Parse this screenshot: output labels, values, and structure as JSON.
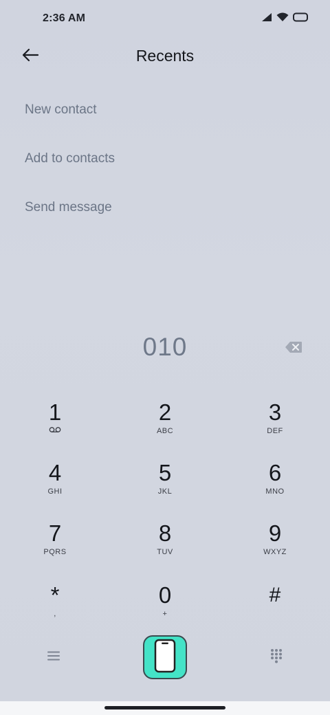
{
  "status_bar": {
    "time": "2:36 AM",
    "icons": [
      "signal-icon",
      "wifi-icon",
      "battery-icon"
    ]
  },
  "header": {
    "back_icon": "arrow-left-icon",
    "title": "Recents"
  },
  "options": [
    {
      "label": "New contact"
    },
    {
      "label": "Add to contacts"
    },
    {
      "label": "Send message"
    }
  ],
  "dialer": {
    "number": "010",
    "backspace_icon": "backspace-icon"
  },
  "keypad": {
    "keys": [
      {
        "digit": "1",
        "letters": "",
        "sub_icon": "voicemail-icon"
      },
      {
        "digit": "2",
        "letters": "ABC"
      },
      {
        "digit": "3",
        "letters": "DEF"
      },
      {
        "digit": "4",
        "letters": "GHI"
      },
      {
        "digit": "5",
        "letters": "JKL"
      },
      {
        "digit": "6",
        "letters": "MNO"
      },
      {
        "digit": "7",
        "letters": "PQRS"
      },
      {
        "digit": "8",
        "letters": "TUV"
      },
      {
        "digit": "9",
        "letters": "WXYZ"
      },
      {
        "digit": "*",
        "letters": ","
      },
      {
        "digit": "0",
        "letters": "+"
      },
      {
        "digit": "#",
        "letters": ""
      }
    ]
  },
  "bottom_bar": {
    "menu_icon": "hamburger-menu-icon",
    "call_icon": "phone-icon",
    "dialpad_icon": "dialpad-grid-icon"
  },
  "colors": {
    "background": "#d3d7e1",
    "call_button": "#44e3c7",
    "muted_text": "#6b7586"
  }
}
